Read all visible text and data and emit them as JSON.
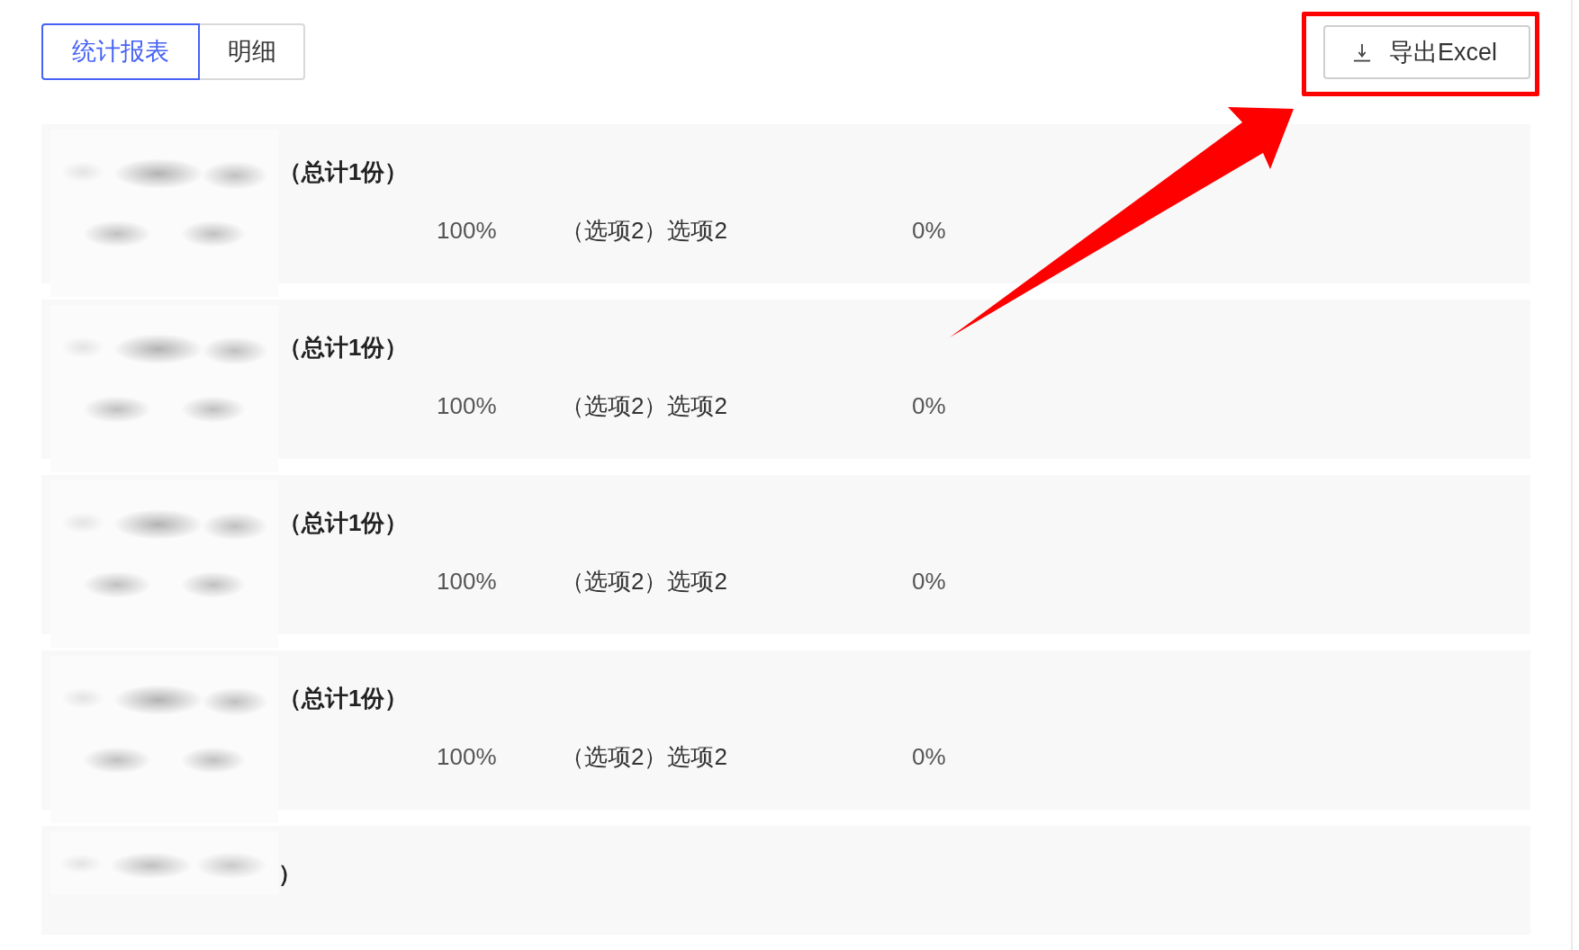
{
  "tabs": [
    {
      "label": "统计报表",
      "selected": true
    },
    {
      "label": "明细",
      "selected": false
    }
  ],
  "export_button": {
    "label": "导出Excel",
    "highlighted": true
  },
  "questions": [
    {
      "redacted": true,
      "heading": "（总计1份）",
      "stats": [
        {
          "kind": "percent",
          "text": "100%"
        },
        {
          "kind": "option",
          "text": "（选项2）选项2"
        },
        {
          "kind": "percent",
          "text": "0%"
        }
      ]
    },
    {
      "redacted": true,
      "heading": "（总计1份）",
      "stats": [
        {
          "kind": "percent",
          "text": "100%"
        },
        {
          "kind": "option",
          "text": "（选项2）选项2"
        },
        {
          "kind": "percent",
          "text": "0%"
        }
      ]
    },
    {
      "redacted": true,
      "heading": "（总计1份）",
      "stats": [
        {
          "kind": "percent",
          "text": "100%"
        },
        {
          "kind": "option",
          "text": "（选项2）选项2"
        },
        {
          "kind": "percent",
          "text": "0%"
        }
      ]
    },
    {
      "redacted": true,
      "heading": "（总计1份）",
      "stats": [
        {
          "kind": "percent",
          "text": "100%"
        },
        {
          "kind": "option",
          "text": "（选项2）选项2"
        },
        {
          "kind": "percent",
          "text": "0%"
        }
      ]
    },
    {
      "redacted": true,
      "heading": "）"
    }
  ]
}
